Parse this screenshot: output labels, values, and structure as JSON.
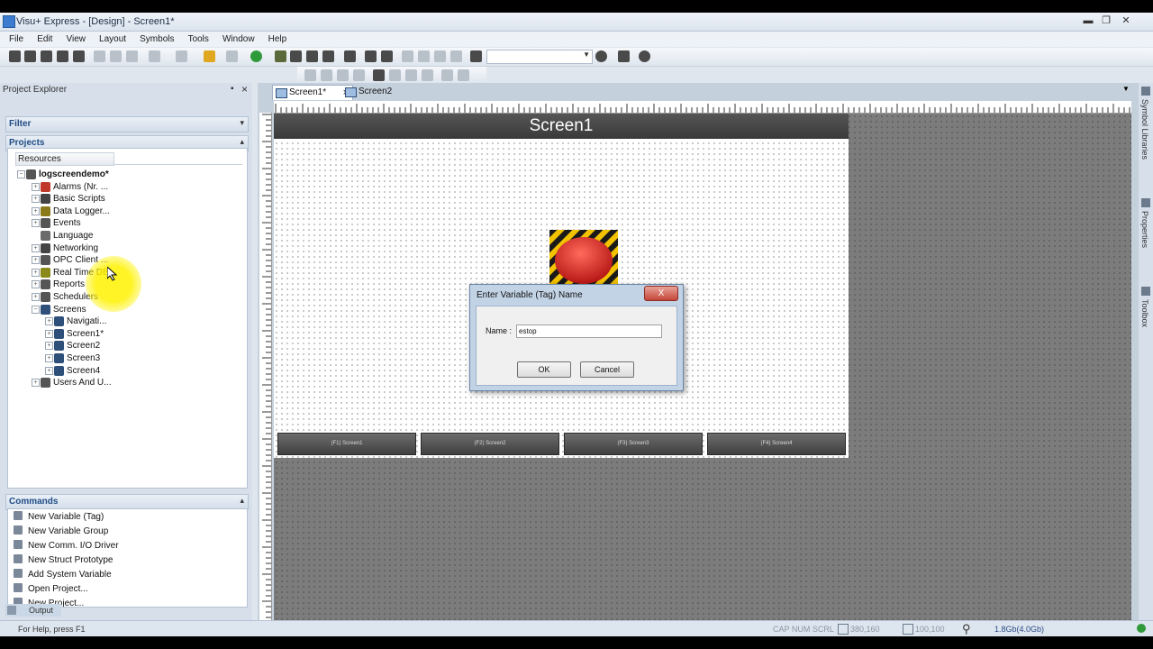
{
  "window": {
    "title": "Visu+ Express - [Design] - Screen1*"
  },
  "menu": [
    "File",
    "Edit",
    "View",
    "Layout",
    "Symbols",
    "Tools",
    "Window",
    "Help"
  ],
  "explorer": {
    "title": "Project Explorer",
    "filter_label": "Filter",
    "projects_label": "Projects",
    "resources_header": "Resources",
    "tree": [
      {
        "label": "logscreendemo*",
        "level": 0,
        "expander": "−",
        "icon_color": "#555555"
      },
      {
        "label": "Alarms (Nr. ...",
        "level": 1,
        "expander": "+",
        "icon_color": "#c0392b"
      },
      {
        "label": "Basic Scripts",
        "level": 1,
        "expander": "+",
        "icon_color": "#444444"
      },
      {
        "label": "Data Logger...",
        "level": 1,
        "expander": "+",
        "icon_color": "#8a7a1a"
      },
      {
        "label": "Events",
        "level": 1,
        "expander": "+",
        "icon_color": "#555555"
      },
      {
        "label": "Language",
        "level": 1,
        "expander": "",
        "icon_color": "#6a6a6a"
      },
      {
        "label": "Networking",
        "level": 1,
        "expander": "+",
        "icon_color": "#444444"
      },
      {
        "label": "OPC Client ...",
        "level": 1,
        "expander": "+",
        "icon_color": "#555555"
      },
      {
        "label": "Real Time DB",
        "level": 1,
        "expander": "+",
        "icon_color": "#8a8a1a"
      },
      {
        "label": "Reports",
        "level": 1,
        "expander": "+",
        "icon_color": "#555555"
      },
      {
        "label": "Schedulers",
        "level": 1,
        "expander": "+",
        "icon_color": "#555555"
      },
      {
        "label": "Screens",
        "level": 1,
        "expander": "−",
        "icon_color": "#2d4f7a"
      },
      {
        "label": "Navigati...",
        "level": 2,
        "expander": "+",
        "icon_color": "#2d4f7a"
      },
      {
        "label": "Screen1*",
        "level": 2,
        "expander": "+",
        "icon_color": "#2d4f7a"
      },
      {
        "label": "Screen2",
        "level": 2,
        "expander": "+",
        "icon_color": "#2d4f7a"
      },
      {
        "label": "Screen3",
        "level": 2,
        "expander": "+",
        "icon_color": "#2d4f7a"
      },
      {
        "label": "Screen4",
        "level": 2,
        "expander": "+",
        "icon_color": "#2d4f7a"
      },
      {
        "label": "Users And U...",
        "level": 1,
        "expander": "+",
        "icon_color": "#555555"
      }
    ]
  },
  "commands": {
    "title": "Commands",
    "items": [
      "New Variable (Tag)",
      "New Variable Group",
      "New Comm. I/O Driver",
      "New Struct Prototype",
      "Add System Variable",
      "Open Project...",
      "New Project..."
    ]
  },
  "tabs": [
    {
      "label": "Screen1*",
      "active": true
    },
    {
      "label": "Screen2",
      "active": false
    }
  ],
  "screen": {
    "title": "Screen1",
    "buttons": [
      "(F1) Screen1",
      "(F2) Screen2",
      "(F3) Screen3",
      "(F4) Screen4"
    ]
  },
  "dialog": {
    "title": "Enter Variable (Tag) Name",
    "close": "X",
    "name_label": "Name :",
    "name_value": "estop",
    "ok": "OK",
    "cancel": "Cancel"
  },
  "side_panels": [
    "Symbol Libraries",
    "Properties",
    "Toolbox"
  ],
  "output_tab": "Output",
  "status": {
    "help": "For Help, press F1",
    "indicators": "CAP  NUM  SCRL",
    "pos": "380,160",
    "size": "100,100",
    "memory": "1.8Gb(4.0Gb)"
  }
}
